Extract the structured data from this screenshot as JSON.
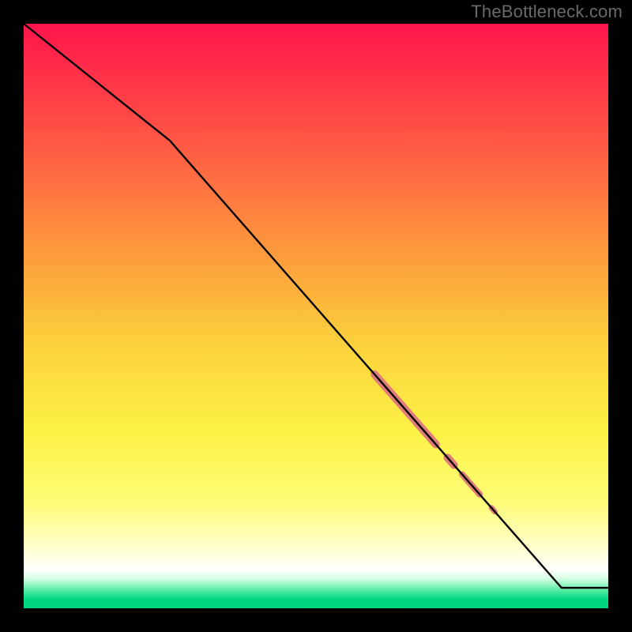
{
  "watermark": "TheBottleneck.com",
  "chart_data": {
    "type": "line",
    "title": "",
    "xlabel": "",
    "ylabel": "",
    "xlim": [
      0,
      100
    ],
    "ylim": [
      0,
      100
    ],
    "grid": false,
    "legend": false,
    "series": [
      {
        "name": "curve",
        "color": "#000000",
        "x": [
          0,
          25,
          92,
          100
        ],
        "values": [
          100,
          80,
          3.5,
          3.5
        ]
      }
    ],
    "highlight_segments": [
      {
        "x_start": 60,
        "x_end": 70.5,
        "width": 10,
        "color": "#e07d7a"
      },
      {
        "x_start": 72.5,
        "x_end": 73.6,
        "width": 10,
        "color": "#e07d7a"
      },
      {
        "x_start": 75,
        "x_end": 78,
        "width": 8,
        "color": "#e07d7a"
      },
      {
        "x_start": 80,
        "x_end": 80.6,
        "width": 7,
        "color": "#e07d7a"
      }
    ],
    "background_gradient": {
      "direction": "vertical",
      "stops": [
        {
          "pos": 0.0,
          "color": "#ff144b"
        },
        {
          "pos": 0.38,
          "color": "#fd963c"
        },
        {
          "pos": 0.7,
          "color": "#fcf246"
        },
        {
          "pos": 0.94,
          "color": "#ffffff"
        },
        {
          "pos": 1.0,
          "color": "#00d27d"
        }
      ]
    }
  }
}
